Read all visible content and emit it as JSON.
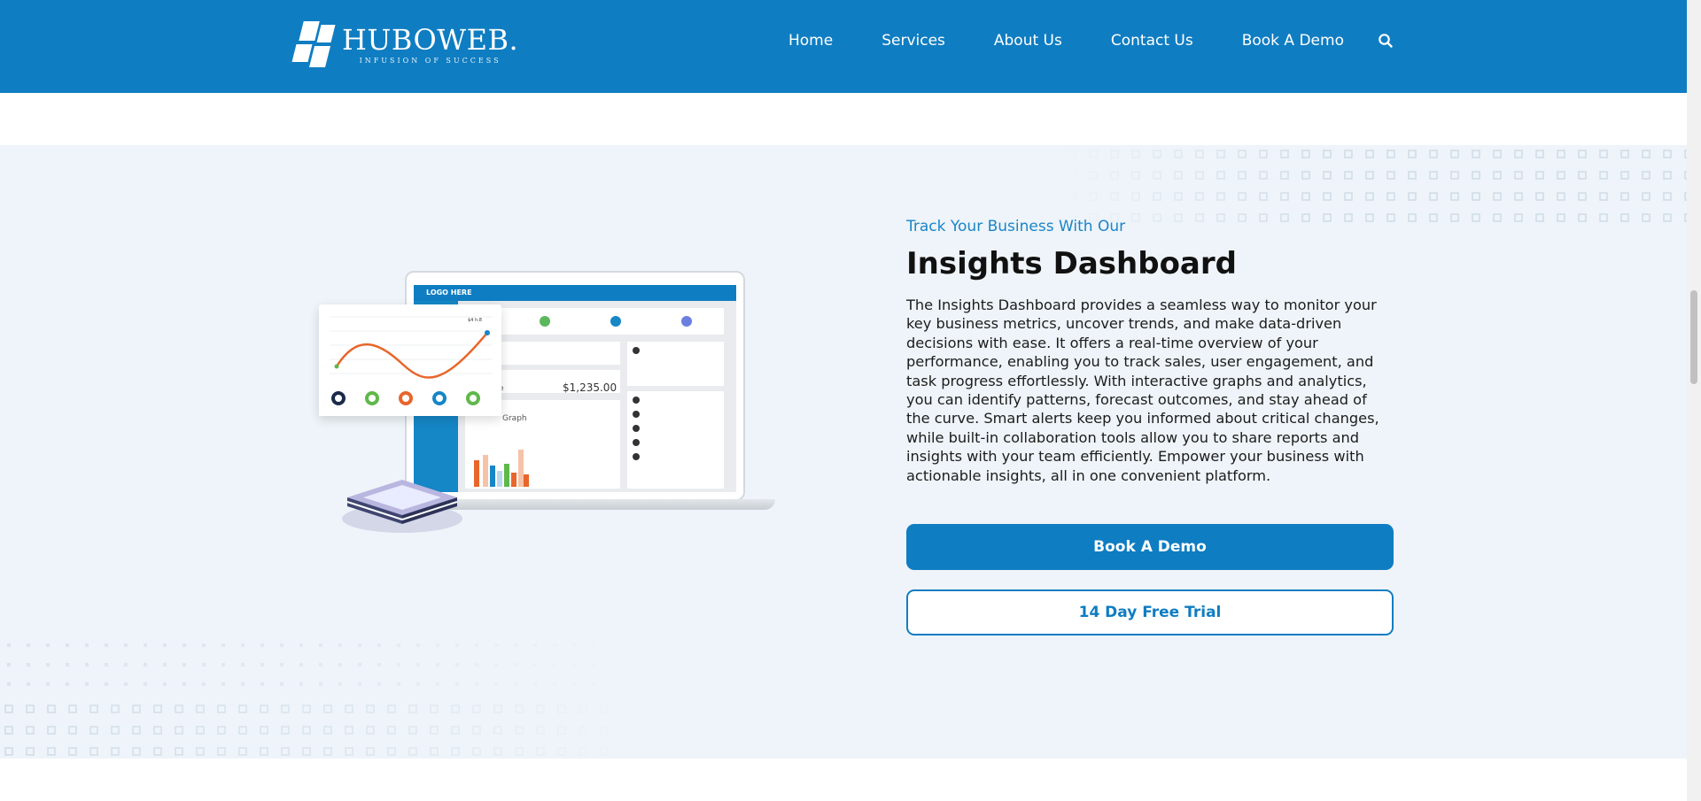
{
  "brand": {
    "name": "HUBOWEB.",
    "tagline": "INFUSION OF SUCCESS",
    "color": "#0f7dc2"
  },
  "nav": {
    "items": [
      "Home",
      "Services",
      "About Us",
      "Contact Us",
      "Book A Demo"
    ],
    "search_icon": "search-icon"
  },
  "hero": {
    "eyebrow": "Track Your Business With Our",
    "title": "Insights Dashboard",
    "description": "The Insights Dashboard provides a seamless way to monitor your key business metrics, uncover trends, and make data-driven decisions with ease. It offers a real-time overview of your performance, enabling you to track sales, user engagement, and task progress effortlessly. With interactive graphs and analytics, you can identify patterns, forecast outcomes, and stay ahead of the curve. Smart alerts keep you informed about critical changes, while built-in collaboration tools allow you to share reports and insights with your team efficiently. Empower your business with actionable insights, all in one convenient platform.",
    "primary_button": "Book A Demo",
    "secondary_button": "14 Day Free Trial"
  },
  "illustration": {
    "screen_logo": "LOGO HERE",
    "balance_label": "lance",
    "balance_value": "$1,235.00",
    "graph_label": "Graph",
    "chart_tag": "$4 h.8 Dec. 2018"
  },
  "colors": {
    "section_bg": "#eef4f9",
    "accent_text": "#1a85c8"
  }
}
